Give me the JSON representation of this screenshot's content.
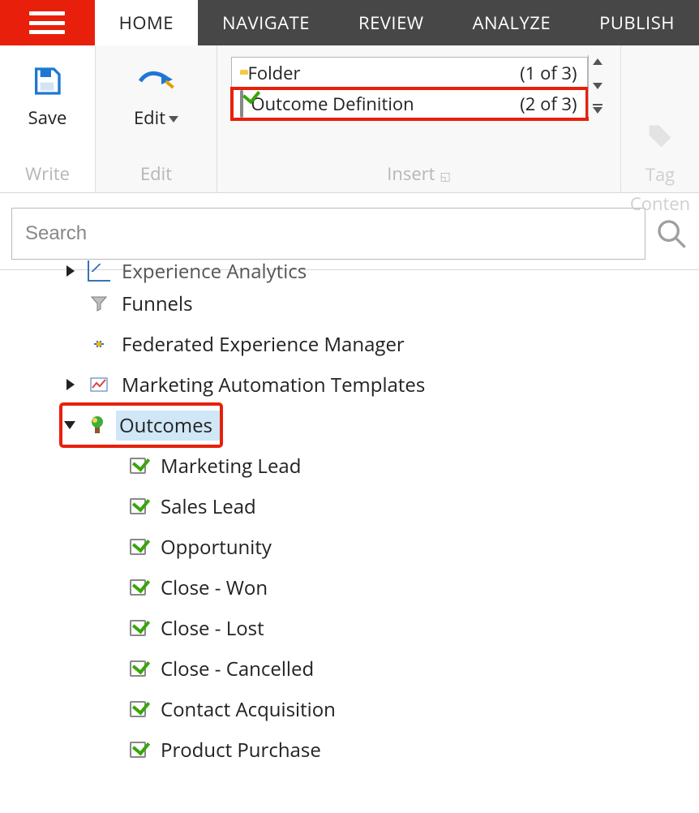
{
  "tabs": {
    "hamburger": "menu",
    "items": [
      "HOME",
      "NAVIGATE",
      "REVIEW",
      "ANALYZE",
      "PUBLISH"
    ],
    "active": 0
  },
  "ribbon": {
    "write": {
      "save_label": "Save",
      "caption": "Write"
    },
    "edit": {
      "edit_label": "Edit",
      "caption": "Edit"
    },
    "insert": {
      "caption": "Insert",
      "items": [
        {
          "name": "Folder",
          "count": "(1 of 3)"
        },
        {
          "name": "Outcome Definition",
          "count": "(2 of 3)"
        }
      ]
    },
    "tag": {
      "label": "Tag",
      "caption": "Conten"
    }
  },
  "search": {
    "placeholder": "Search"
  },
  "tree": {
    "cutoff": {
      "label": "Experience Analytics"
    },
    "nodes": [
      {
        "label": "Funnels",
        "icon": "funnel"
      },
      {
        "label": "Federated Experience Manager",
        "icon": "plug"
      },
      {
        "label": "Marketing Automation Templates",
        "icon": "chartline",
        "expandable": true,
        "collapsed": true
      },
      {
        "label": "Outcomes",
        "icon": "outcome",
        "expandable": true,
        "collapsed": false,
        "selected": true,
        "children": [
          {
            "label": "Marketing Lead"
          },
          {
            "label": "Sales Lead"
          },
          {
            "label": "Opportunity"
          },
          {
            "label": "Close - Won"
          },
          {
            "label": "Close - Lost"
          },
          {
            "label": "Close - Cancelled"
          },
          {
            "label": "Contact Acquisition"
          },
          {
            "label": "Product Purchase"
          }
        ]
      }
    ]
  }
}
